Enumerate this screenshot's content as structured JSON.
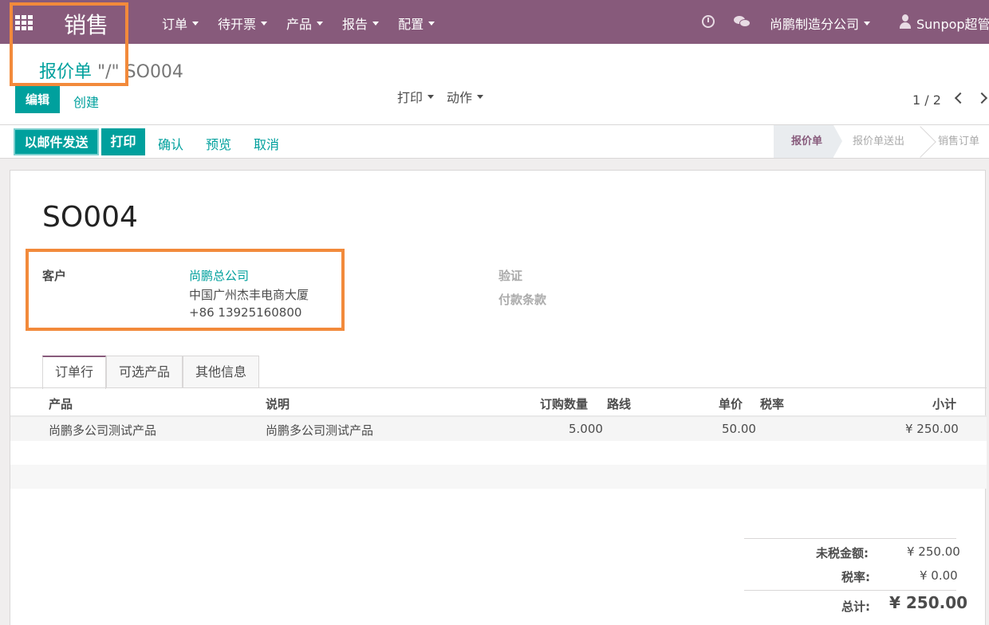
{
  "topbar": {
    "app_title": "销售",
    "menu": [
      {
        "label": "订单"
      },
      {
        "label": "待开票"
      },
      {
        "label": "产品"
      },
      {
        "label": "报告"
      },
      {
        "label": "配置"
      }
    ],
    "company": "尚鹏制造分公司",
    "user": "Sunpop超管"
  },
  "control": {
    "breadcrumb_parent": "报价单",
    "breadcrumb_sep": " \"/\" ",
    "breadcrumb_current": "SO004",
    "edit_label": "编辑",
    "create_label": "创建",
    "print_label": "打印",
    "action_label": "动作",
    "pager": "1 / 2"
  },
  "statusbar": {
    "buttons": [
      "以邮件发送",
      "打印"
    ],
    "links": [
      "确认",
      "预览",
      "取消"
    ],
    "stages": [
      "报价单",
      "报价单送出",
      "销售订单"
    ],
    "active_stage": "报价单"
  },
  "form": {
    "title": "SO004",
    "customer_label": "客户",
    "customer_name": "尚鹏总公司",
    "customer_address": "中国广州杰丰电商大厦",
    "customer_phone": "+86 13925160800",
    "validity_label": "验证",
    "payment_terms_label": "付款条款"
  },
  "tabs": [
    "订单行",
    "可选产品",
    "其他信息"
  ],
  "order_lines": {
    "columns": [
      "产品",
      "说明",
      "订购数量",
      "路线",
      "单价",
      "税率",
      "小计"
    ],
    "rows": [
      {
        "product": "尚鹏多公司测试产品",
        "description": "尚鹏多公司测试产品",
        "qty": "5.000",
        "route": "",
        "price_unit": "50.00",
        "tax": "",
        "subtotal": "¥ 250.00"
      }
    ]
  },
  "totals": {
    "untaxed_label": "未税金额:",
    "untaxed_value": "¥ 250.00",
    "tax_label": "税率:",
    "tax_value": "¥ 0.00",
    "total_label": "总计:",
    "total_value": "¥ 250.00"
  },
  "colors": {
    "brand": "#875a7b",
    "accent": "#00a09d",
    "highlight": "#f28a3b"
  }
}
